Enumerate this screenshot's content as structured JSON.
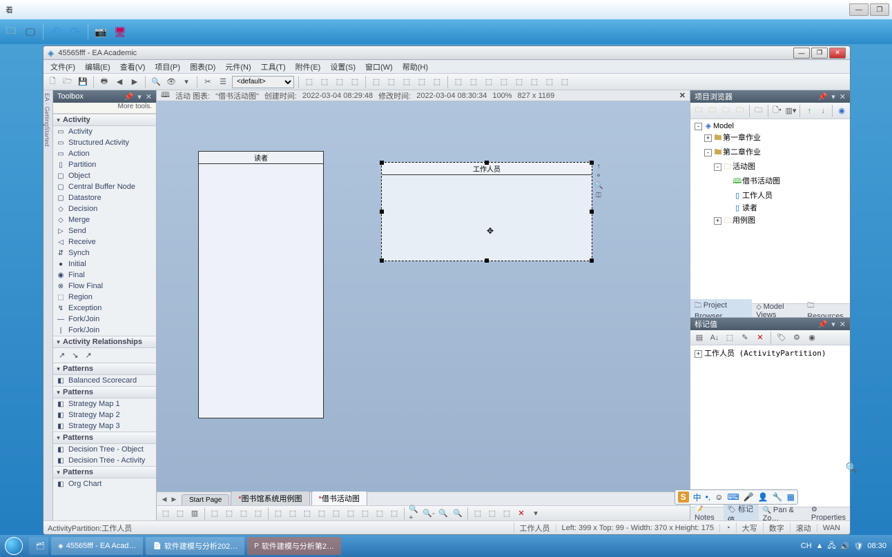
{
  "outer": {
    "unknown_char": "着"
  },
  "quickbar_icons": [
    "folder",
    "monitor",
    "undo",
    "redo",
    "camera",
    "share"
  ],
  "inner_window": {
    "title": "45565fff - EA Academic"
  },
  "menu": [
    "文件(F)",
    "编辑(E)",
    "查看(V)",
    "项目(P)",
    "图表(D)",
    "元件(N)",
    "工具(T)",
    "附件(E)",
    "设置(S)",
    "窗口(W)",
    "帮助(H)"
  ],
  "toolbar_select": "<default>",
  "toolbox": {
    "title": "Toolbox",
    "more": "More tools.",
    "sections": [
      {
        "label": "Activity",
        "items": [
          {
            "ico": "▭",
            "label": "Activity"
          },
          {
            "ico": "▭",
            "label": "Structured Activity"
          },
          {
            "ico": "▭",
            "label": "Action"
          },
          {
            "ico": "▯",
            "label": "Partition"
          },
          {
            "ico": "▢",
            "label": "Object"
          },
          {
            "ico": "▢",
            "label": "Central Buffer Node"
          },
          {
            "ico": "▢",
            "label": "Datastore"
          },
          {
            "ico": "◇",
            "label": "Decision"
          },
          {
            "ico": "◇",
            "label": "Merge"
          },
          {
            "ico": "▷",
            "label": "Send"
          },
          {
            "ico": "◁",
            "label": "Receive"
          },
          {
            "ico": "⇵",
            "label": "Synch"
          },
          {
            "ico": "●",
            "label": "Initial"
          },
          {
            "ico": "◉",
            "label": "Final"
          },
          {
            "ico": "⊗",
            "label": "Flow Final"
          },
          {
            "ico": "⬚",
            "label": "Region"
          },
          {
            "ico": "↯",
            "label": "Exception"
          },
          {
            "ico": "—",
            "label": "Fork/Join"
          },
          {
            "ico": "|",
            "label": "Fork/Join"
          }
        ]
      },
      {
        "label": "Activity Relationships",
        "items": [
          {
            "ico": "↗",
            "label": " "
          },
          {
            "ico": "↘",
            "label": " "
          },
          {
            "ico": "↗",
            "label": " "
          }
        ],
        "inline": true
      },
      {
        "label": "Patterns",
        "items": [
          {
            "ico": "◧",
            "label": "Balanced Scorecard"
          }
        ]
      },
      {
        "label": "Patterns",
        "items": [
          {
            "ico": "◧",
            "label": "Strategy Map 1"
          },
          {
            "ico": "◧",
            "label": "Strategy Map 2"
          },
          {
            "ico": "◧",
            "label": "Strategy Map 3"
          }
        ]
      },
      {
        "label": "Patterns",
        "items": [
          {
            "ico": "◧",
            "label": "Decision Tree - Object"
          },
          {
            "ico": "◧",
            "label": "Decision Tree - Activity"
          }
        ]
      },
      {
        "label": "Patterns",
        "items": [
          {
            "ico": "◧",
            "label": "Org Chart"
          }
        ]
      }
    ]
  },
  "diagram": {
    "header_prefix": "活动 图表:",
    "header_name": "\"借书活动图\"",
    "created_label": "创建时间:",
    "created": "2022-03-04 08:29:48",
    "modified_label": "修改时间:",
    "modified": "2022-03-04 08:30:34",
    "zoom": "100%",
    "size": "827 x 1169",
    "partition1": "读者",
    "partition2": "工作人员"
  },
  "tabs": {
    "start": "Start Page",
    "t1": "图书馆系统用例图",
    "t2": "借书活动图"
  },
  "browser": {
    "title": "项目浏览器",
    "root": "Model",
    "pkg1": "第一章作业",
    "pkg2": "第二章作业",
    "folder_activity": "活动图",
    "diag": "借书活动图",
    "el1": "工作人员",
    "el2": "读者",
    "folder_usecase": "用例图",
    "tab1": "Project Browser",
    "tab2": "Model Views",
    "tab3": "Resources"
  },
  "tag": {
    "title": "标记值",
    "line": "工作人员 (ActivityPartition)"
  },
  "bottom_tabs": [
    "Notes",
    "标记值",
    "Pan & Zo…",
    "Properties"
  ],
  "status": {
    "selection": "ActivityPartition:工作人员",
    "element": "工作人员",
    "coords": "Left:  399 x Top:   99 - Width:  370 x Height:  175",
    "mode1": "大写",
    "mode2": "数字",
    "mode3": "滚动",
    "wan": "WAN"
  },
  "taskbar": {
    "t1": "45565fff - EA Acad…",
    "t2": "软件建模与分析202…",
    "t3": "软件建模与分析第2…",
    "clock": "08:30",
    "tray": [
      "CH",
      "🔊",
      "⚡",
      "🕒"
    ]
  }
}
